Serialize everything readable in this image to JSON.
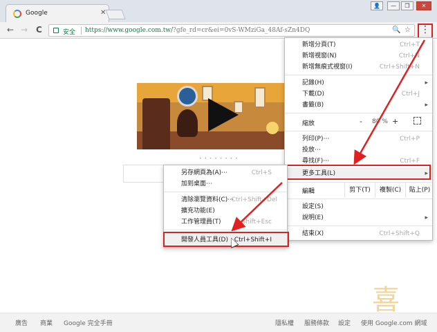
{
  "browser": {
    "tab_title": "Google",
    "tab_close": "✕",
    "window_buttons": [
      "👤",
      "—",
      "❐",
      "✕"
    ],
    "nav_back": "←",
    "nav_forward": "→",
    "nav_reload": "C",
    "nav_home": "⌂",
    "secure_label": "安全",
    "url_main": "https://www.google.com.tw/",
    "url_rest": "?gfe_rd=cr&ei=0vS-WMziGa_48Af-sZn4DQ",
    "zoom_icon": "🔍",
    "star_icon": "☆",
    "menu_icon": "⋮"
  },
  "footer": {
    "left": [
      "廣告",
      "商業",
      "Google 完全手冊"
    ],
    "right": [
      "隱私權",
      "服務條款",
      "設定",
      "使用 Google.com 網域"
    ]
  },
  "watermark": "喜",
  "main_menu": {
    "items": [
      {
        "label": "新增分頁(T)",
        "shortcut": "Ctrl+T"
      },
      {
        "label": "新增視窗(N)",
        "shortcut": "Ctrl+N"
      },
      {
        "label": "新增無痕式視窗(I)",
        "shortcut": "Ctrl+Shift+N"
      },
      {
        "label": "記錄(H)",
        "arrow": "▸"
      },
      {
        "label": "下載(D)",
        "shortcut": "Ctrl+J"
      },
      {
        "label": "書籤(B)",
        "arrow": "▸"
      },
      {
        "label": "列印(P)⋯",
        "shortcut": "Ctrl+P"
      },
      {
        "label": "投放⋯"
      },
      {
        "label": "尋找(F)⋯",
        "shortcut": "Ctrl+F"
      },
      {
        "label": "更多工具(L)",
        "arrow": "▸"
      },
      {
        "label": "設定(S)"
      },
      {
        "label": "說明(E)",
        "arrow": "▸"
      },
      {
        "label": "結束(X)",
        "shortcut": "Ctrl+Shift+Q"
      }
    ],
    "zoom": {
      "label": "縮放",
      "minus": "-",
      "value": "80 %",
      "plus": "+"
    },
    "edit": {
      "label": "編輯",
      "cut": "剪下(T)",
      "copy": "複製(C)",
      "paste": "貼上(P)"
    }
  },
  "submenu": {
    "items": [
      {
        "label": "另存網頁為(A)⋯",
        "shortcut": "Ctrl+S"
      },
      {
        "label": "加到桌面⋯"
      },
      {
        "label": "清除瀏覽資料(C)⋯",
        "shortcut": "Ctrl+Shift+Del"
      },
      {
        "label": "擴充功能(E)"
      },
      {
        "label": "工作管理員(T)",
        "shortcut": "Shift+Esc"
      },
      {
        "label": "開發人員工具(D)",
        "shortcut": "Ctrl+Shift+I"
      }
    ]
  },
  "colors": {
    "annotation_red": "#e02020",
    "secure_green": "#0b8043"
  }
}
